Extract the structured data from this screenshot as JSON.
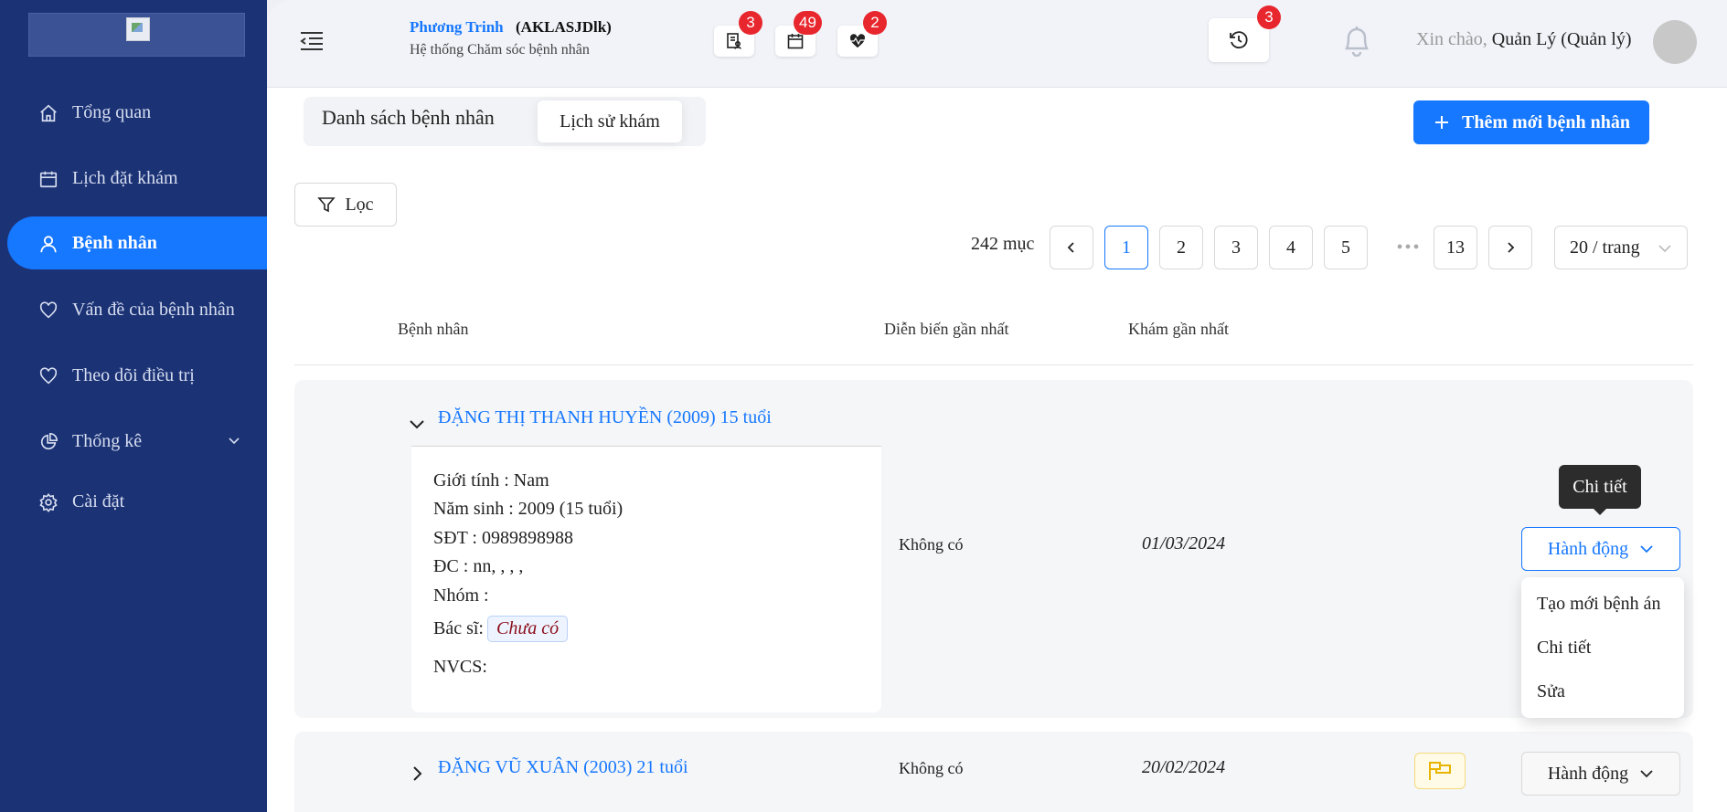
{
  "sidebar": {
    "items": [
      {
        "label": "Tổng quan",
        "icon": "home-icon"
      },
      {
        "label": "Lịch đặt khám",
        "icon": "calendar-icon"
      },
      {
        "label": "Bệnh nhân",
        "icon": "user-icon",
        "active": true
      },
      {
        "label": "Vấn đề của bệnh nhân",
        "icon": "heart-icon"
      },
      {
        "label": "Theo dõi điều trị",
        "icon": "heart-icon"
      },
      {
        "label": "Thống kê",
        "icon": "pie-chart-icon"
      },
      {
        "label": "Cài đặt",
        "icon": "gear-icon"
      }
    ]
  },
  "header": {
    "user_name": "Phương Trinh",
    "user_code": "(AKLASJDlk)",
    "system_name": "Hệ thống Chăm sóc bệnh nhân",
    "badges": {
      "records": "3",
      "calendar": "49",
      "health": "2",
      "history": "3"
    },
    "greeting_prefix": "Xin chào,",
    "greeting_role": "Quản Lý (Quản lý)"
  },
  "main": {
    "tab_list": "Danh sách bệnh nhân",
    "tab_history": "Lịch sử khám",
    "add_button": "Thêm mới bệnh nhân",
    "filter_button": "Lọc",
    "pagination": {
      "total": "242 mục",
      "pages": [
        "1",
        "2",
        "3",
        "4",
        "5"
      ],
      "last_page": "13",
      "ellipsis": "•••",
      "page_size": "20 / trang"
    },
    "columns": {
      "patient": "Bệnh nhân",
      "latest_progress": "Diễn biến gần nhất",
      "latest_exam": "Khám gần nhất"
    },
    "rows": [
      {
        "name": "ĐẶNG THỊ THANH HUYỀN (2009) 15 tuổi",
        "gender": "Giới tính : Nam",
        "birth_year": "Năm sinh : 2009 (15 tuổi)",
        "phone": "SĐT : 0989898988",
        "address": "ĐC : nn, , , ,",
        "group": "Nhóm :",
        "doctor_label": "Bác sĩ:",
        "doctor_value": "Chưa có",
        "nurse": "NVCS:",
        "progress": "Không có",
        "exam_date": "01/03/2024",
        "action": "Hành động"
      },
      {
        "name": "ĐẶNG VŨ XUÂN (2003) 21 tuổi",
        "progress": "Không có",
        "exam_date": "20/02/2024",
        "action": "Hành động"
      }
    ],
    "tooltip": "Chi tiết",
    "dropdown": [
      "Tạo mới bệnh án",
      "Chi tiết",
      "Sửa"
    ]
  }
}
